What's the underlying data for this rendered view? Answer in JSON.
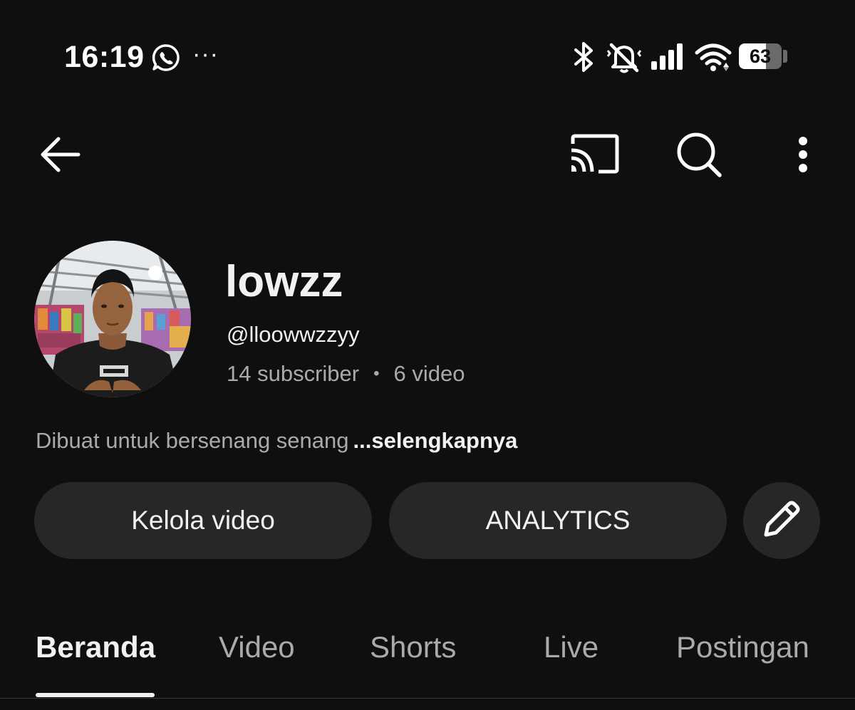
{
  "status_bar": {
    "time": "16:19",
    "more": "···",
    "battery_level": "63",
    "battery_fraction": 0.63,
    "icons": [
      "whatsapp-icon",
      "bluetooth-icon",
      "silent-mode-icon",
      "signal-icon",
      "wifi-icon",
      "battery-icon"
    ]
  },
  "app_bar": {
    "icons": [
      "back-arrow-icon",
      "cast-icon",
      "search-icon",
      "more-vert-icon"
    ]
  },
  "channel": {
    "name": "lowzz",
    "handle": "@lloowwzzyy",
    "subscribers": "14 subscriber",
    "separator": "•",
    "videos": "6 video",
    "description": "Dibuat untuk bersenang senang",
    "more_label": "...selengkapnya"
  },
  "actions": {
    "manage_label": "Kelola video",
    "analytics_label": "ANALYTICS",
    "edit_icon": "pencil-icon"
  },
  "tabs": [
    {
      "label": "Beranda",
      "active": true
    },
    {
      "label": "Video",
      "active": false
    },
    {
      "label": "Shorts",
      "active": false
    },
    {
      "label": "Live",
      "active": false
    },
    {
      "label": "Postingan",
      "active": false
    }
  ],
  "colors": {
    "background": "#0f0f0f",
    "button_bg": "#272727",
    "primary_text": "#f1f1f1",
    "secondary_text": "#aaaaaa"
  }
}
